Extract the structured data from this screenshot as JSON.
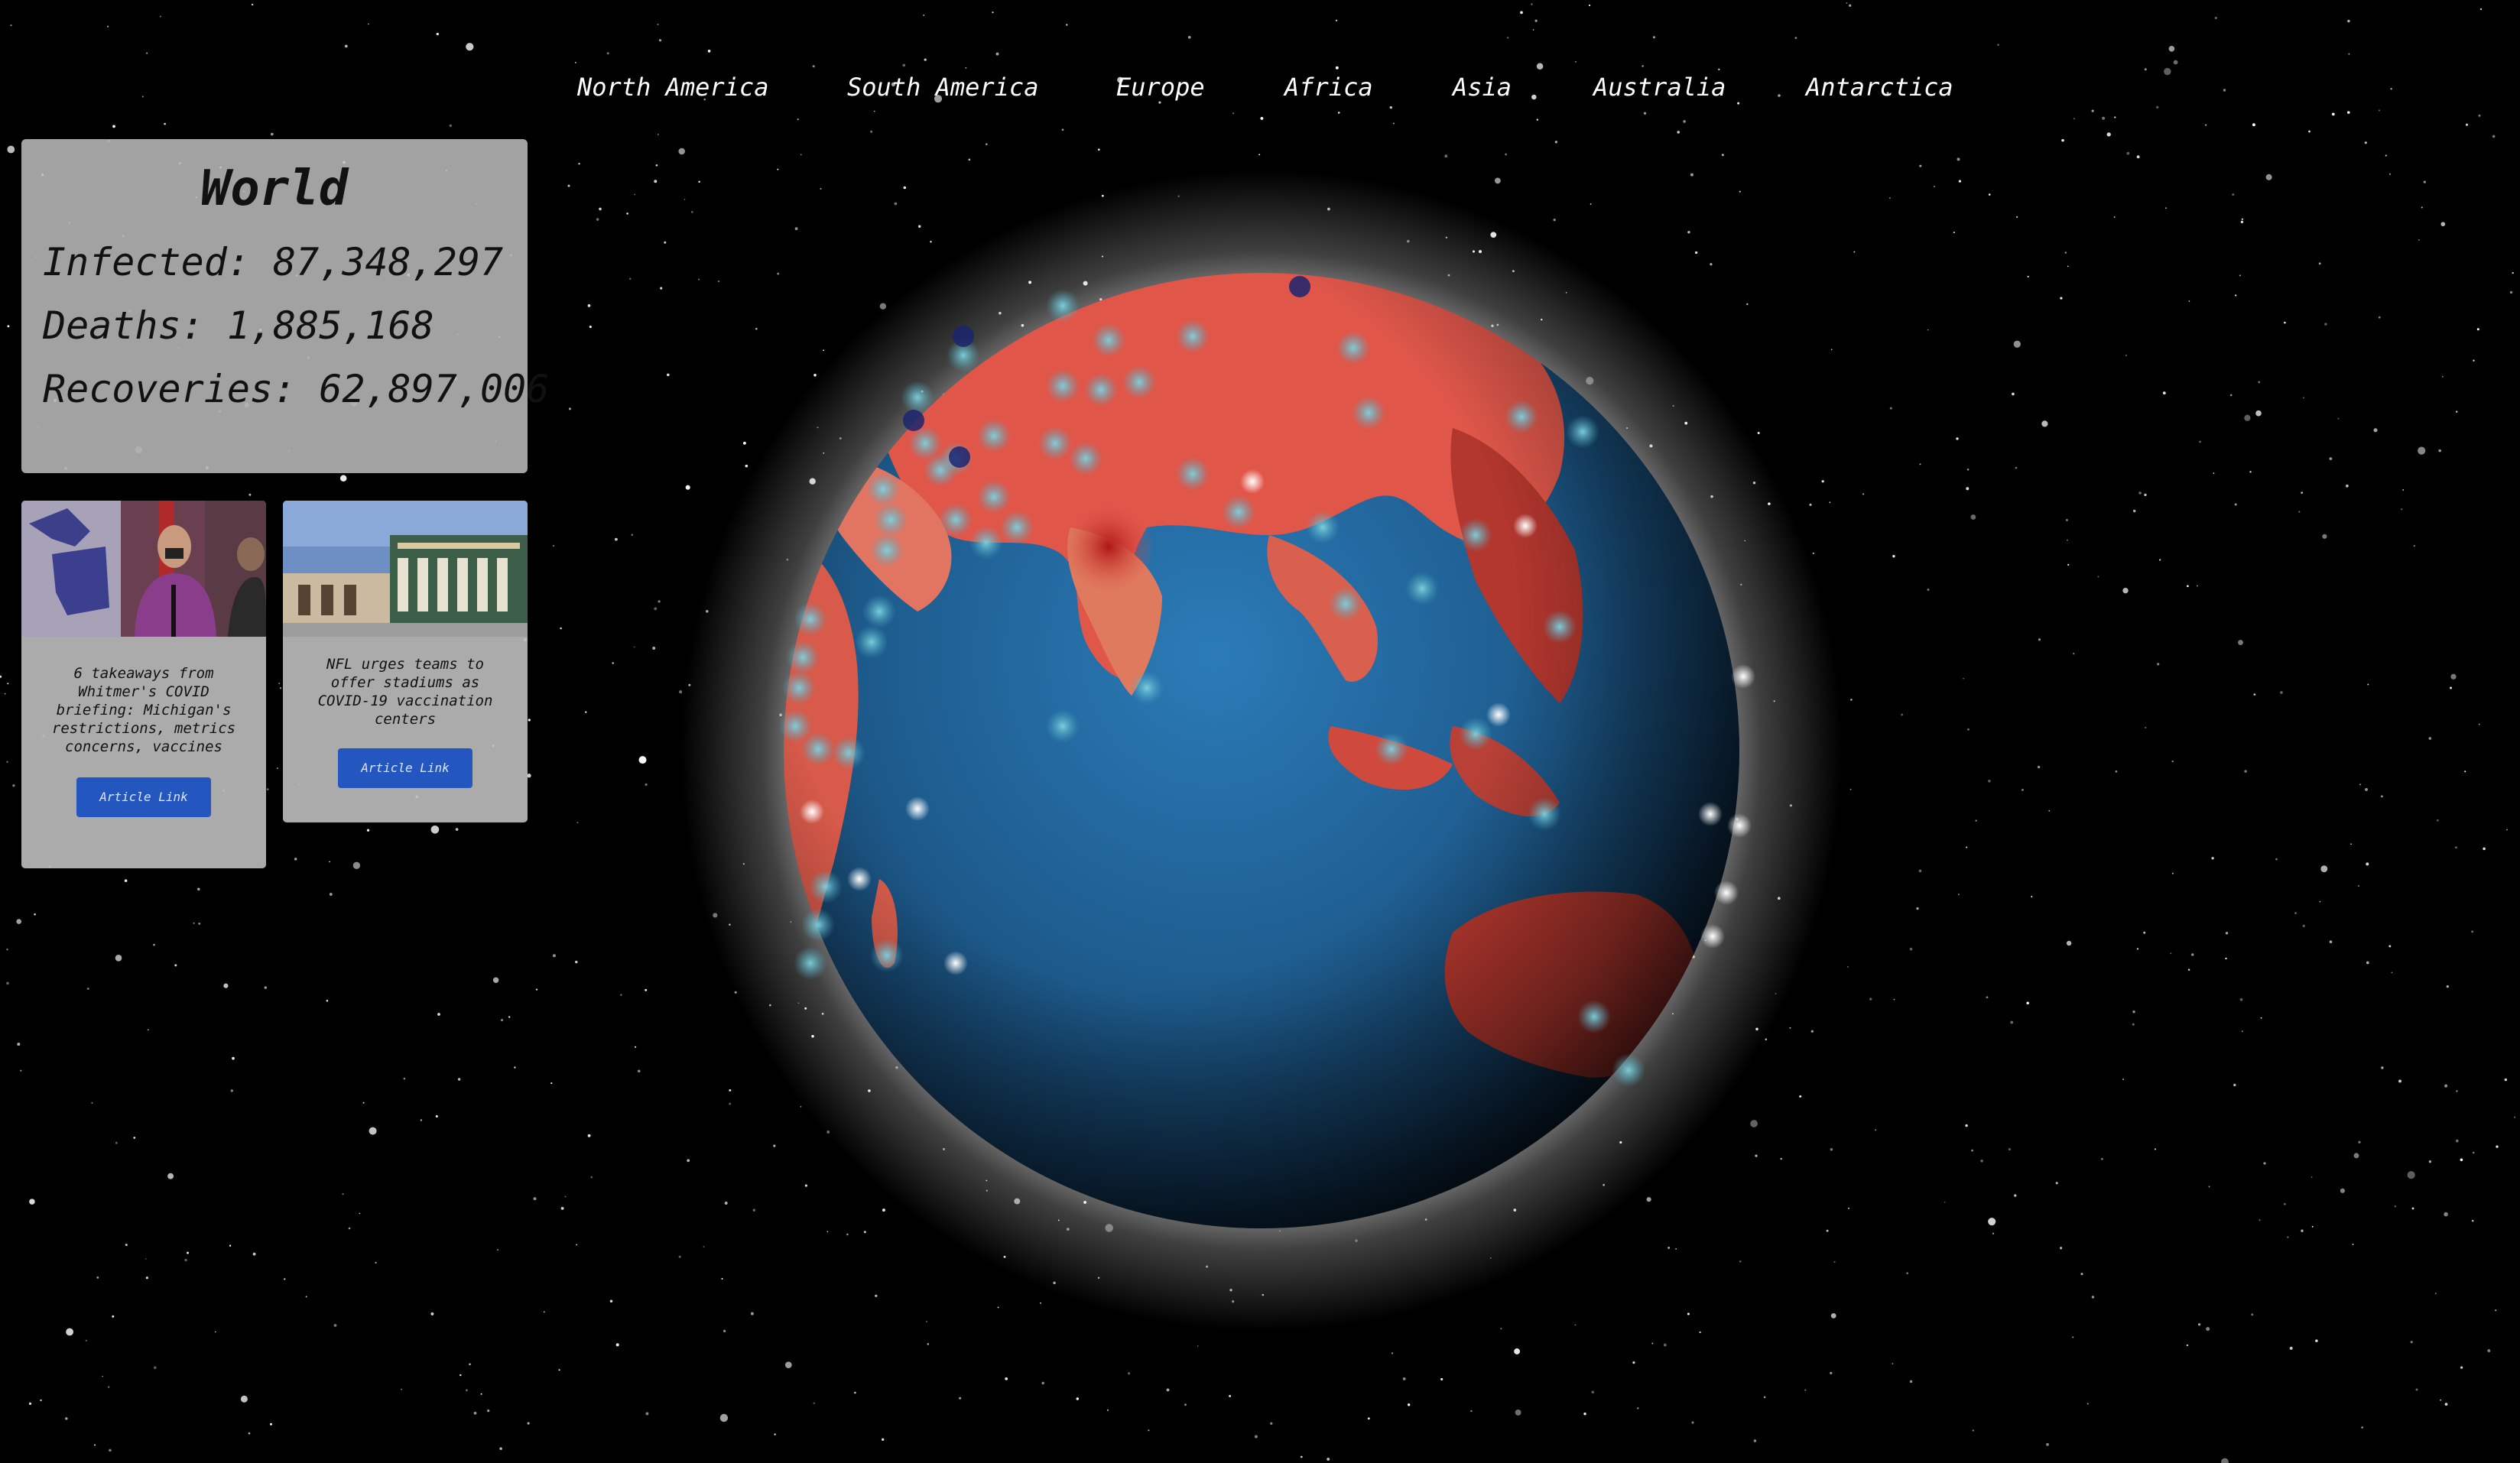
{
  "nav": {
    "items": [
      {
        "label": "North America"
      },
      {
        "label": "South America"
      },
      {
        "label": "Europe"
      },
      {
        "label": "Africa"
      },
      {
        "label": "Asia"
      },
      {
        "label": "Australia"
      },
      {
        "label": "Antarctica"
      }
    ]
  },
  "stats": {
    "title": "World",
    "infected": "Infected: 87,348,297",
    "deaths": "Deaths: 1,885,168",
    "recoveries": "Recoveries: 62,897,006"
  },
  "articles": [
    {
      "headline": "6 takeaways from Whitmer's COVID briefing: Michigan's restrictions, metrics concerns, vaccines",
      "button_label": "Article Link",
      "image": "press-briefing-photo"
    },
    {
      "headline": "NFL urges teams to offer stadiums as COVID-19 vaccination centers",
      "button_label": "Article Link",
      "image": "stadium-photo"
    }
  ],
  "globe": {
    "image": "rotating-earth-globe",
    "land_color": "#e0574a",
    "ocean_color": "#1f5f93",
    "hotspot_color": "#b81f1f",
    "marker_color": "#6ec6d6"
  }
}
